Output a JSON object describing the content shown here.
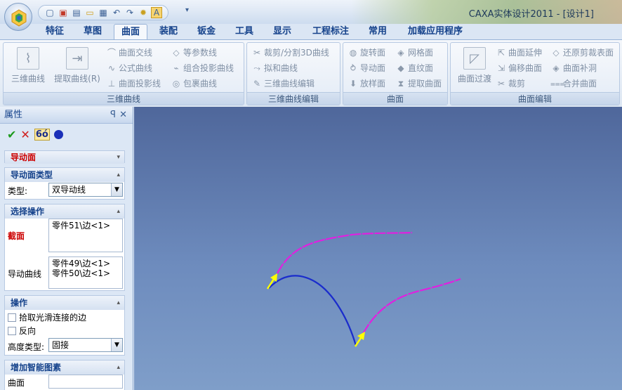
{
  "app": {
    "title": "CAXA实体设计2011 - [设计1]"
  },
  "qat": {
    "icons": [
      "new-icon",
      "open-icon",
      "import-icon",
      "folder-icon",
      "save-icon",
      "undo-icon",
      "redo-icon",
      "settings-icon",
      "text-icon"
    ]
  },
  "tabs": [
    "特征",
    "草图",
    "曲面",
    "装配",
    "钣金",
    "工具",
    "显示",
    "工程标注",
    "常用",
    "加载应用程序"
  ],
  "active_tab": "曲面",
  "ribbon": {
    "group1": {
      "label": "三维曲线",
      "big1": "三维曲线",
      "big2": "提取曲线(R)",
      "items": [
        "曲面交线",
        "公式曲线",
        "曲面投影线",
        "等参数线",
        "组合投影曲线",
        "包裹曲线"
      ]
    },
    "group2": {
      "label": "三维曲线编辑",
      "items": [
        "裁剪/分割3D曲线",
        "拟和曲线",
        "三维曲线编辑"
      ]
    },
    "group3": {
      "label": "曲面",
      "items": [
        "旋转面",
        "导动面",
        "放样面",
        "网格面",
        "直纹面",
        "提取曲面"
      ]
    },
    "group4": {
      "label": "曲面编辑",
      "big1": "曲面过渡",
      "items": [
        "曲面延伸",
        "偏移曲面",
        "裁剪",
        "还原剪裁表面",
        "曲面补洞",
        "合并曲面"
      ]
    }
  },
  "panel": {
    "title": "属性",
    "pin": "ꟼ",
    "close": "✕",
    "ok": "✔",
    "cancel": "✕",
    "preview": "6ó",
    "section0": "导动面",
    "section1": "导动面类型",
    "type_label": "类型:",
    "type_value": "双导动线",
    "section2": "选择操作",
    "profile_label": "截面",
    "profile_value": "零件51\\边<1>",
    "guide_label": "导动曲线",
    "guide_values": [
      "零件49\\边<1>",
      "零件50\\边<1>"
    ],
    "section3": "操作",
    "option1": "拾取光滑连接的边",
    "option2": "反向",
    "height_label": "高度类型:",
    "height_value": "固接",
    "section4": "增加智能图素",
    "surface_label": "曲面"
  },
  "colors": {
    "viewport_top": "#4f679b",
    "viewport_bottom": "#7f9ec9",
    "guide": "#e020e0",
    "profile": "#1a2ccc",
    "arrow": "#ffff00",
    "error": "#cc0000"
  }
}
